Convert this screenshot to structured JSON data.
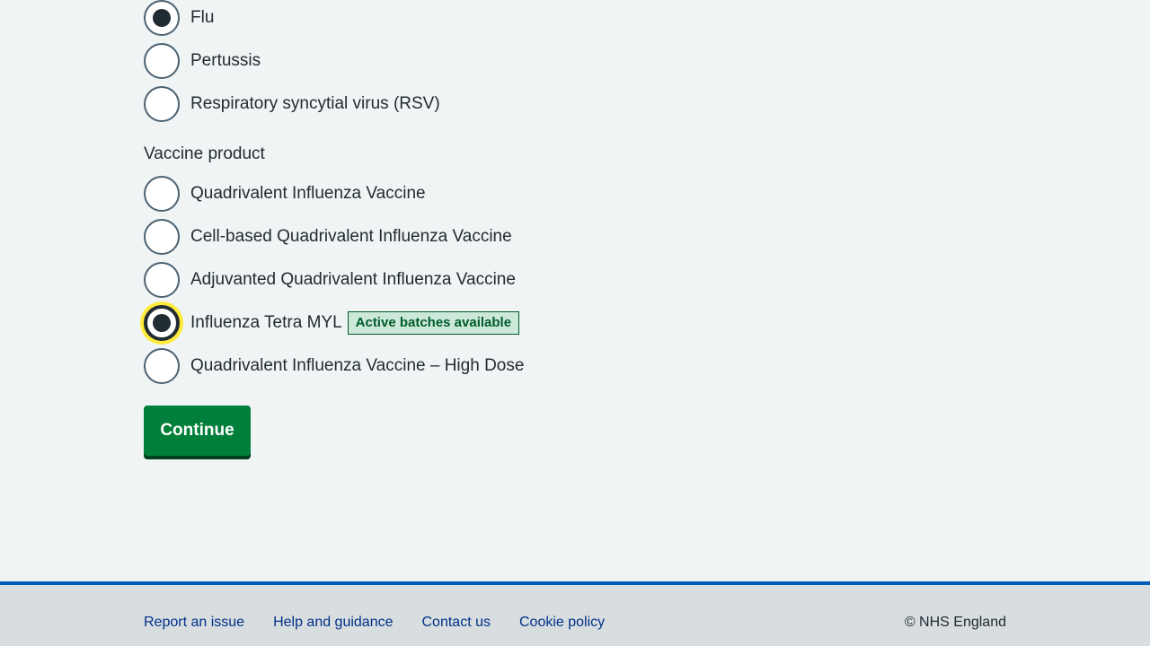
{
  "vaccine_type": {
    "options": [
      {
        "label": "Flu",
        "checked": true
      },
      {
        "label": "Pertussis",
        "checked": false
      },
      {
        "label": "Respiratory syncytial virus (RSV)",
        "checked": false
      }
    ]
  },
  "vaccine_product": {
    "legend": "Vaccine product",
    "options": [
      {
        "label": "Quadrivalent Influenza Vaccine",
        "checked": false
      },
      {
        "label": "Cell-based Quadrivalent Influenza Vaccine",
        "checked": false
      },
      {
        "label": "Adjuvanted Quadrivalent Influenza Vaccine",
        "checked": false
      },
      {
        "label": "Influenza Tetra MYL",
        "checked": true,
        "tag": "Active batches available"
      },
      {
        "label": "Quadrivalent Influenza Vaccine – High Dose",
        "checked": false
      }
    ]
  },
  "continue_button": {
    "label": "Continue"
  },
  "footer": {
    "links": [
      "Report an issue",
      "Help and guidance",
      "Contact us",
      "Cookie policy"
    ],
    "copyright": "© NHS England"
  },
  "colors": {
    "background": "#f0f4f5",
    "button_green": "#007f3b",
    "focus_yellow": "#ffeb3b",
    "footer_blue": "#005eb8",
    "link_blue": "#003087",
    "tag_green": "#005c2a"
  }
}
